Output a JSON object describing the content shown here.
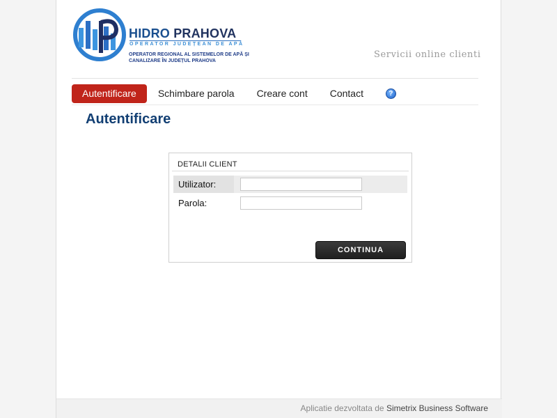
{
  "header": {
    "brand_title_1": "HIDRO",
    "brand_title_2": "PRAHOVA",
    "brand_subtitle": "OPERATOR JUDEȚEAN DE APĂ",
    "brand_description": "OPERATOR REGIONAL AL SISTEMELOR DE APĂ ȘI CANALIZARE ÎN JUDEȚUL PRAHOVA",
    "services_text": "Servicii online clienti"
  },
  "nav": {
    "items": [
      {
        "label": "Autentificare",
        "active": true
      },
      {
        "label": "Schimbare parola"
      },
      {
        "label": "Creare cont"
      },
      {
        "label": "Contact"
      }
    ],
    "help_symbol": "?"
  },
  "page_title": "Autentificare",
  "form": {
    "section_title": "DETALII CLIENT",
    "username_label": "Utilizator:",
    "username_value": "",
    "password_label": "Parola:",
    "password_value": "",
    "submit_label": "CONTINUA"
  },
  "footer": {
    "prefix": "Aplicatie dezvoltata de",
    "company": "Simetrix Business Software"
  },
  "colors": {
    "accent_red": "#c0241a",
    "title_blue": "#123f73",
    "brand_blue": "#1a4f8f"
  },
  "icons": {
    "logo": "hidro-prahova-logo",
    "help": "help-icon"
  }
}
